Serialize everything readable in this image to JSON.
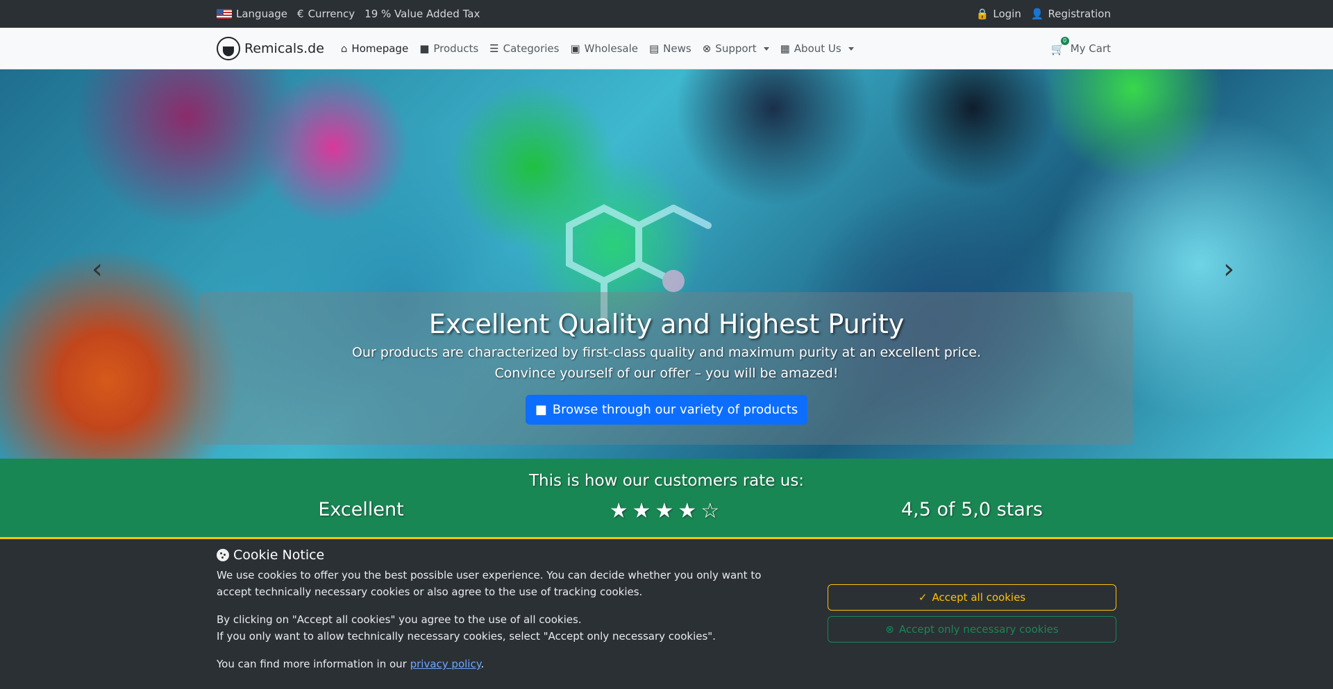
{
  "topbar": {
    "language": "Language",
    "currency": "Currency",
    "currency_symbol": "€",
    "vat": "19 % Value Added Tax",
    "login": "Login",
    "registration": "Registration"
  },
  "navbar": {
    "brand": "Remicals.de",
    "links": [
      {
        "label": "Homepage",
        "icon": "home-icon"
      },
      {
        "label": "Products",
        "icon": "boxes-icon"
      },
      {
        "label": "Categories",
        "icon": "layers-icon"
      },
      {
        "label": "Wholesale",
        "icon": "briefcase-icon"
      },
      {
        "label": "News",
        "icon": "newspaper-icon"
      },
      {
        "label": "Support",
        "icon": "lifebuoy-icon"
      },
      {
        "label": "About Us",
        "icon": "building-icon"
      }
    ],
    "cart_label": "My Cart",
    "cart_count": "0"
  },
  "hero": {
    "title": "Excellent Quality and Highest Purity",
    "line1": "Our products are characterized by first-class quality and maximum purity at an excellent price.",
    "line2": "Convince yourself of our offer – you will be amazed!",
    "cta": "Browse through our variety of products"
  },
  "ratings": {
    "title": "This is how our customers rate us:",
    "label": "Excellent",
    "stars": "★★★★☆",
    "score": "4,5 of 5,0 stars",
    "rating_value": 4.5
  },
  "cookie": {
    "title": "Cookie Notice",
    "p1": "We use cookies to offer you the best possible user experience. You can decide whether you only want to accept technically necessary cookies or also agree to the use of tracking cookies.",
    "p2a": "By clicking on \"Accept all cookies\" you agree to the use of all cookies.",
    "p2b": "If you only want to allow technically necessary cookies, select \"Accept only necessary cookies\".",
    "p3_prefix": "You can find more information in our ",
    "p3_link": "privacy policy",
    "p3_suffix": ".",
    "accept_all": "Accept all cookies",
    "accept_necessary": "Accept only necessary cookies"
  },
  "colors": {
    "topbar_bg": "#2b3035",
    "rating_bg": "#198754",
    "accent_yellow": "#ffc107",
    "primary_blue": "#0d6efd"
  }
}
